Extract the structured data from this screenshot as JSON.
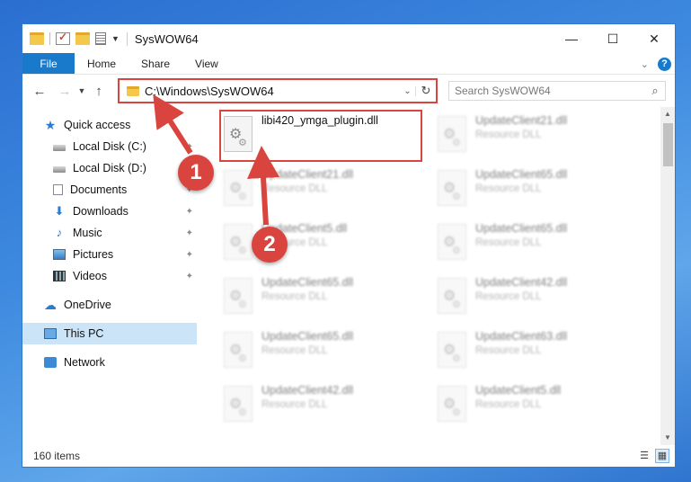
{
  "window": {
    "title": "SysWOW64"
  },
  "window_controls": {
    "minimize": "—",
    "maximize": "☐",
    "close": "✕"
  },
  "ribbon": {
    "tabs": [
      "File",
      "Home",
      "Share",
      "View"
    ],
    "help": "?"
  },
  "navigation": {
    "address_path": "C:\\Windows\\SysWOW64",
    "search_placeholder": "Search SysWOW64"
  },
  "sidebar": {
    "quick_access": "Quick access",
    "pinned": [
      "Local Disk (C:)",
      "Local Disk (D:)",
      "Documents",
      "Downloads",
      "Music",
      "Pictures",
      "Videos"
    ],
    "onedrive": "OneDrive",
    "this_pc": "This PC",
    "network": "Network"
  },
  "files": [
    {
      "name": "libi420_ymga_plugin.dll",
      "type": ""
    },
    {
      "name": "UpdateClient21.dll",
      "type": "Resource DLL"
    },
    {
      "name": "UpdateClient21.dll",
      "type": "Resource DLL"
    },
    {
      "name": "UpdateClient65.dll",
      "type": "Resource DLL"
    },
    {
      "name": "UpdateClient5.dll",
      "type": "Resource DLL"
    },
    {
      "name": "UpdateClient65.dll",
      "type": "Resource DLL"
    },
    {
      "name": "UpdateClient65.dll",
      "type": "Resource DLL"
    },
    {
      "name": "UpdateClient42.dll",
      "type": "Resource DLL"
    },
    {
      "name": "UpdateClient65.dll",
      "type": "Resource DLL"
    },
    {
      "name": "UpdateClient63.dll",
      "type": "Resource DLL"
    },
    {
      "name": "UpdateClient42.dll",
      "type": "Resource DLL"
    },
    {
      "name": "UpdateClient5.dll",
      "type": "Resource DLL"
    }
  ],
  "status": {
    "item_count": "160 items"
  },
  "annotations": {
    "step1": "1",
    "step2": "2",
    "color": "#d9443f"
  }
}
